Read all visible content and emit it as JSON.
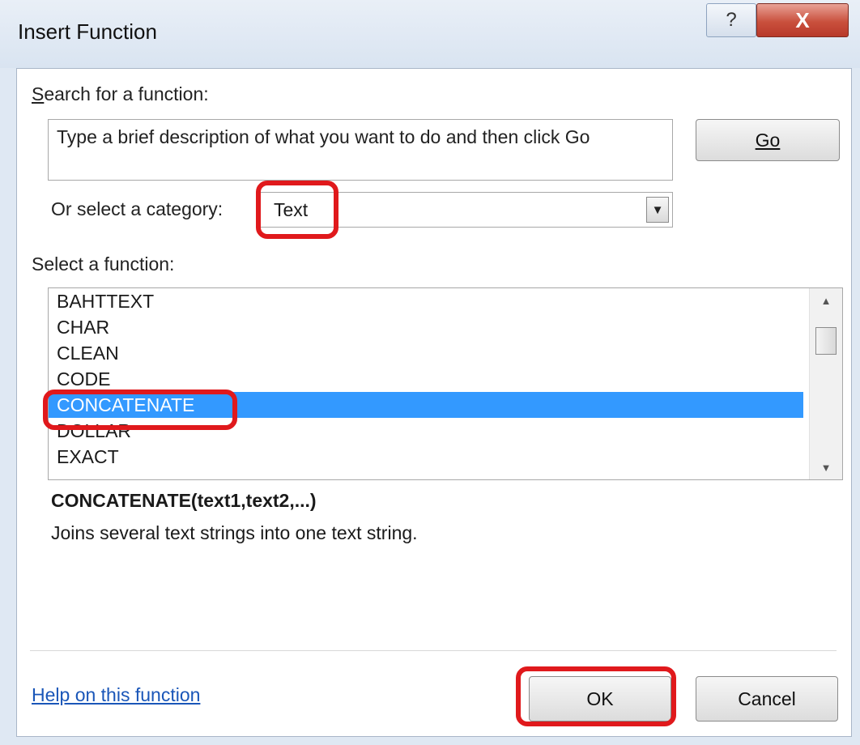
{
  "window": {
    "title": "Insert Function",
    "help_glyph": "?",
    "close_glyph": "X"
  },
  "search": {
    "label": "Search for a function:",
    "value": "Type a brief description of what you want to do and then click Go",
    "go_label": "Go"
  },
  "category": {
    "label": "Or select a category:",
    "selected": "Text"
  },
  "functions": {
    "label": "Select a function:",
    "items": [
      "BAHTTEXT",
      "CHAR",
      "CLEAN",
      "CODE",
      "CONCATENATE",
      "DOLLAR",
      "EXACT"
    ],
    "selected": "CONCATENATE"
  },
  "details": {
    "syntax": "CONCATENATE(text1,text2,...)",
    "description": "Joins several text strings into one text string."
  },
  "footer": {
    "help_link": "Help on this function",
    "ok_label": "OK",
    "cancel_label": "Cancel"
  },
  "colors": {
    "selection": "#3399ff",
    "highlight": "#e0191c",
    "link": "#1a56b8"
  }
}
